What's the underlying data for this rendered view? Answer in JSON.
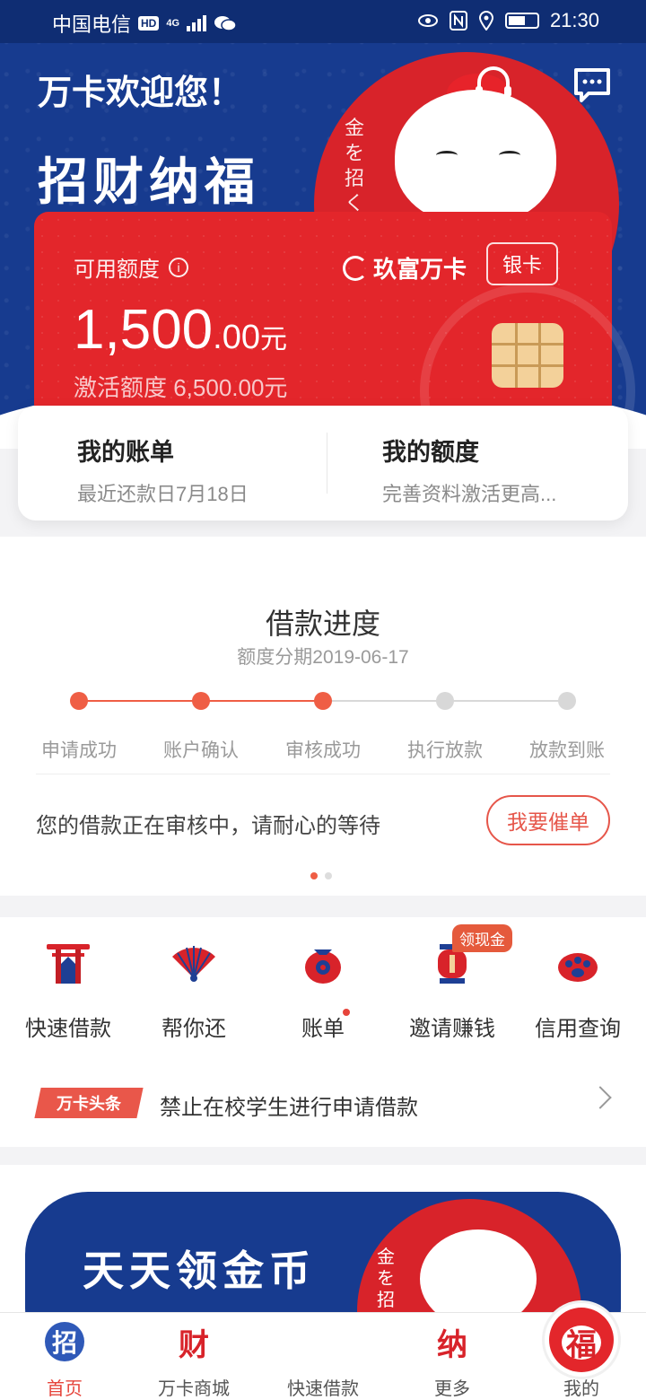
{
  "status_bar": {
    "carrier": "中国电信",
    "hd_badge": "HD",
    "network": "4G",
    "time": "21:30"
  },
  "header": {
    "welcome": "万卡欢迎您！",
    "slogan": "招财纳福",
    "vertical_text": "金を招く"
  },
  "card": {
    "available_label": "可用额度",
    "brand": "玖富万卡",
    "card_type": "银卡",
    "amount_int": "1,500",
    "amount_dec": ".00",
    "amount_unit": "元",
    "activate_text": "激活额度 6,500.00元"
  },
  "bill_panel": {
    "bill_title": "我的账单",
    "bill_sub": "最近还款日7月18日",
    "limit_title": "我的额度",
    "limit_sub": "完善资料激活更高..."
  },
  "loan_progress": {
    "title": "借款进度",
    "subtitle": "额度分期2019-06-17",
    "steps": [
      {
        "label": "申请成功",
        "done": true
      },
      {
        "label": "账户确认",
        "done": true
      },
      {
        "label": "审核成功",
        "done": true
      },
      {
        "label": "执行放款",
        "done": false
      },
      {
        "label": "放款到账",
        "done": false
      }
    ],
    "message": "您的借款正在审核中，请耐心的等待",
    "urge_button": "我要催单",
    "page_count": 2,
    "page_index": 1
  },
  "quick_menu": {
    "items": [
      {
        "label": "快速借款",
        "icon": "torii-gate-icon"
      },
      {
        "label": "帮你还",
        "icon": "fan-icon"
      },
      {
        "label": "账单",
        "icon": "money-bag-icon"
      },
      {
        "label": "邀请赚钱",
        "icon": "lantern-icon"
      },
      {
        "label": "信用查询",
        "icon": "paw-icon"
      }
    ],
    "invite_badge": "领现金"
  },
  "news": {
    "tag": "万卡头条",
    "text": "禁止在校学生进行申请借款"
  },
  "banner": {
    "text": "天天领金币",
    "vertical_text": "金を招く"
  },
  "tab_bar": {
    "items": [
      {
        "label": "首页",
        "glyph": "招",
        "active": true
      },
      {
        "label": "万卡商城",
        "glyph": "财",
        "active": false
      },
      {
        "label": "快速借款",
        "glyph": "",
        "active": false
      },
      {
        "label": "更多",
        "glyph": "纳",
        "active": false
      },
      {
        "label": "我的",
        "glyph": "福",
        "active": false
      }
    ]
  },
  "colors": {
    "brand_blue": "#173b8f",
    "brand_red": "#e3262b",
    "accent": "#ef5e45",
    "inactive_gray": "#d8d8d8"
  }
}
